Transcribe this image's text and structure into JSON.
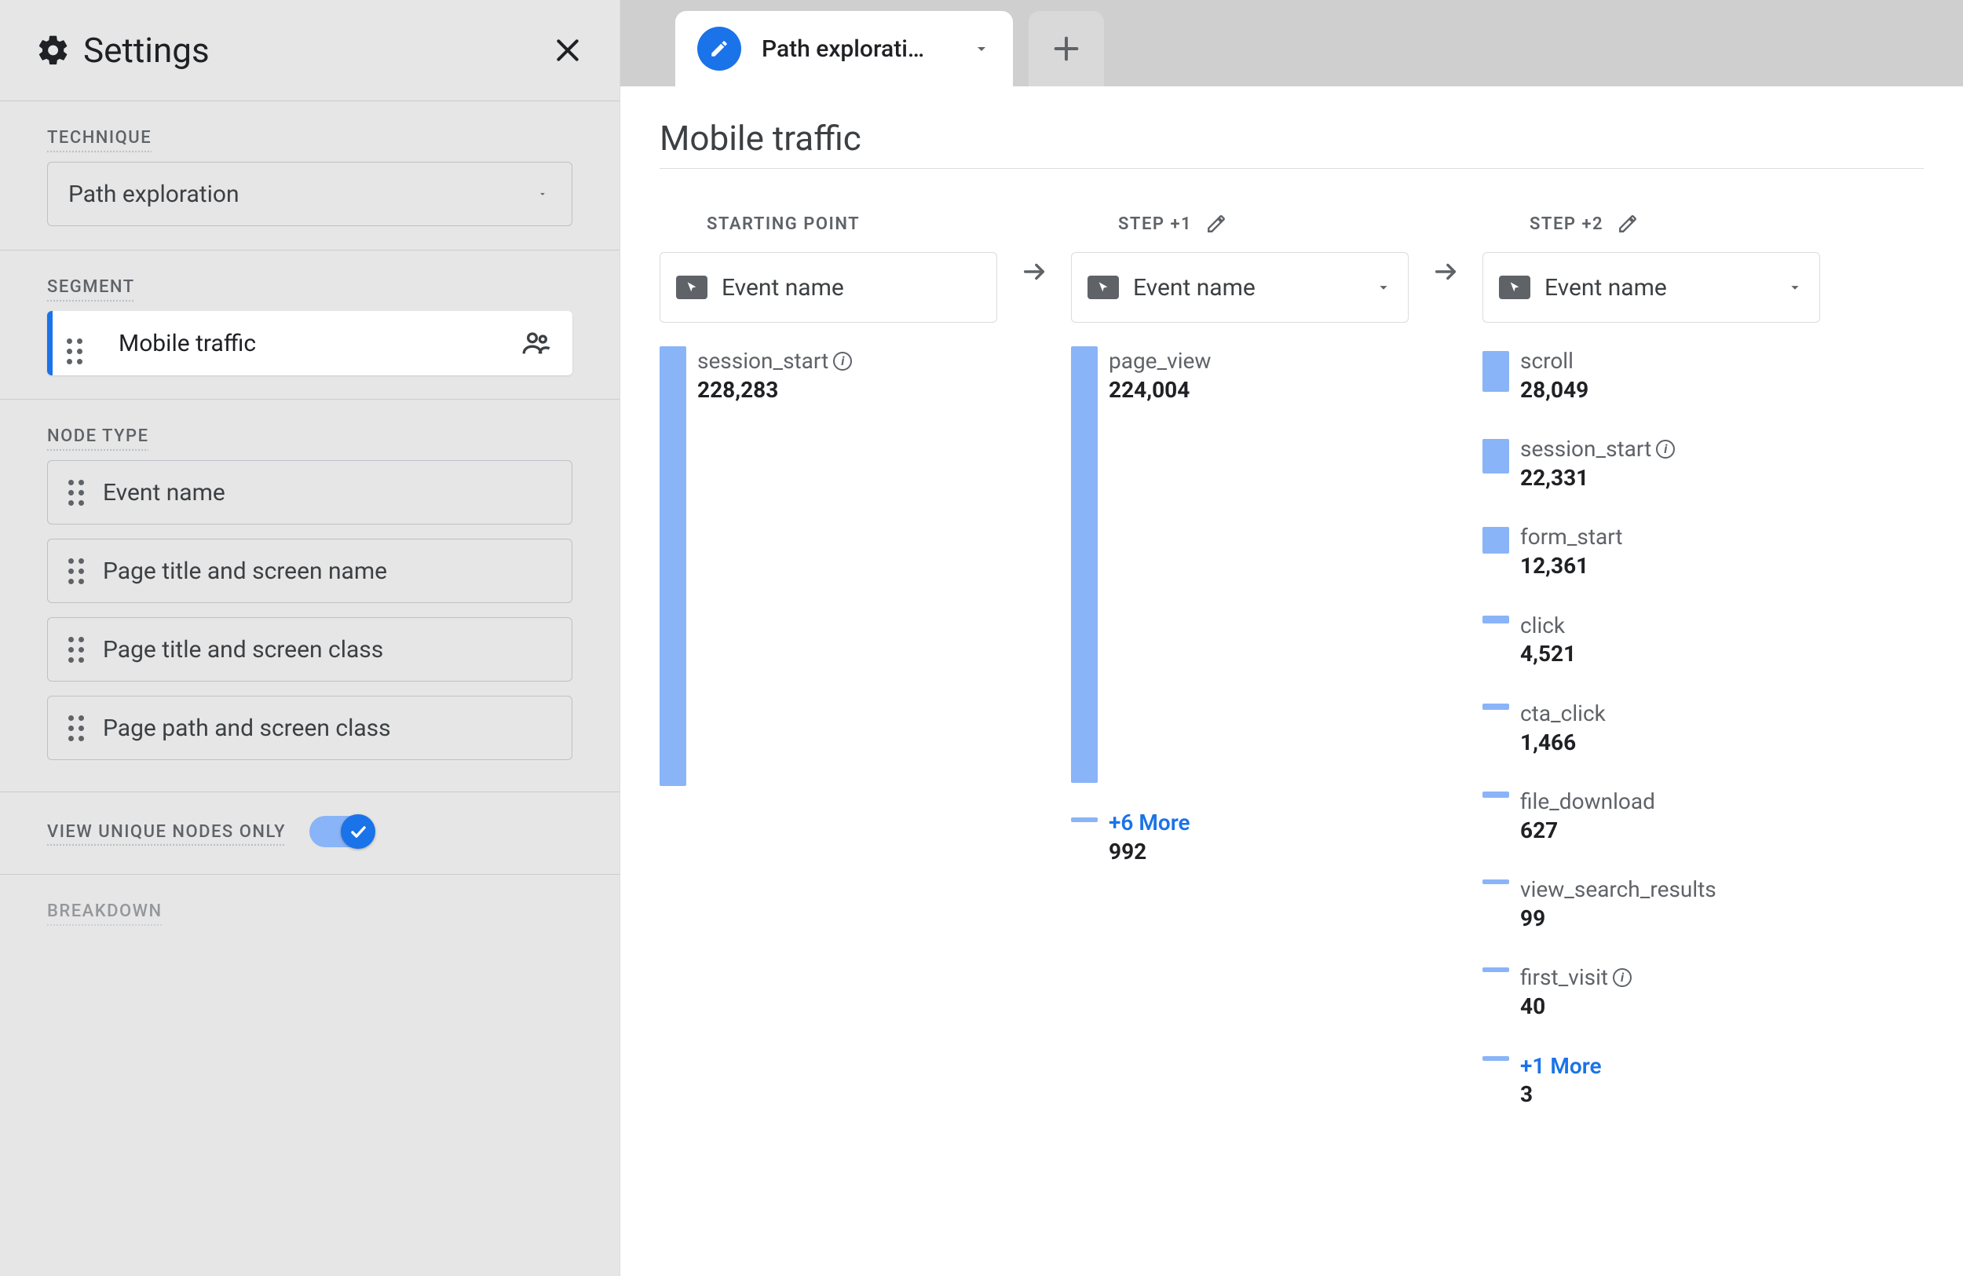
{
  "sidebar": {
    "title": "Settings",
    "sections": {
      "technique": {
        "label": "TECHNIQUE",
        "value": "Path exploration"
      },
      "segment": {
        "label": "SEGMENT",
        "chip": "Mobile traffic"
      },
      "node_type": {
        "label": "NODE TYPE",
        "items": [
          "Event name",
          "Page title and screen name",
          "Page title and screen class",
          "Page path and screen class"
        ]
      },
      "unique": {
        "label": "VIEW UNIQUE NODES ONLY",
        "enabled": true
      },
      "breakdown": {
        "label": "BREAKDOWN"
      }
    }
  },
  "tab": {
    "label": "Path explorati…"
  },
  "canvas": {
    "title": "Mobile traffic",
    "steps": {
      "start": {
        "header": "STARTING POINT",
        "dimension": "Event name",
        "nodes": [
          {
            "name": "session_start",
            "value": "228,283",
            "info": true
          }
        ]
      },
      "step1": {
        "header": "STEP +1",
        "dimension": "Event name",
        "nodes": [
          {
            "name": "page_view",
            "value": "224,004"
          },
          {
            "name": "+6 More",
            "value": "992",
            "link": true
          }
        ]
      },
      "step2": {
        "header": "STEP +2",
        "dimension": "Event name",
        "nodes": [
          {
            "name": "scroll",
            "value": "28,049"
          },
          {
            "name": "session_start",
            "value": "22,331",
            "info": true
          },
          {
            "name": "form_start",
            "value": "12,361"
          },
          {
            "name": "click",
            "value": "4,521"
          },
          {
            "name": "cta_click",
            "value": "1,466"
          },
          {
            "name": "file_download",
            "value": "627"
          },
          {
            "name": "view_search_results",
            "value": "99"
          },
          {
            "name": "first_visit",
            "value": "40",
            "info": true
          },
          {
            "name": "+1 More",
            "value": "3",
            "link": true
          }
        ]
      }
    }
  },
  "chart_data": {
    "type": "sankey",
    "title": "Mobile traffic — Path exploration",
    "segment": "Mobile traffic",
    "dimension": "Event name",
    "steps": [
      {
        "label": "STARTING POINT",
        "nodes": [
          {
            "name": "session_start",
            "value": 228283
          }
        ]
      },
      {
        "label": "STEP +1",
        "nodes": [
          {
            "name": "page_view",
            "value": 224004
          },
          {
            "name": "+6 More",
            "value": 992,
            "collapsed_count": 6
          }
        ]
      },
      {
        "label": "STEP +2",
        "nodes": [
          {
            "name": "scroll",
            "value": 28049
          },
          {
            "name": "session_start",
            "value": 22331
          },
          {
            "name": "form_start",
            "value": 12361
          },
          {
            "name": "click",
            "value": 4521
          },
          {
            "name": "cta_click",
            "value": 1466
          },
          {
            "name": "file_download",
            "value": 627
          },
          {
            "name": "view_search_results",
            "value": 99
          },
          {
            "name": "first_visit",
            "value": 40
          },
          {
            "name": "+1 More",
            "value": 3,
            "collapsed_count": 1
          }
        ]
      }
    ]
  }
}
